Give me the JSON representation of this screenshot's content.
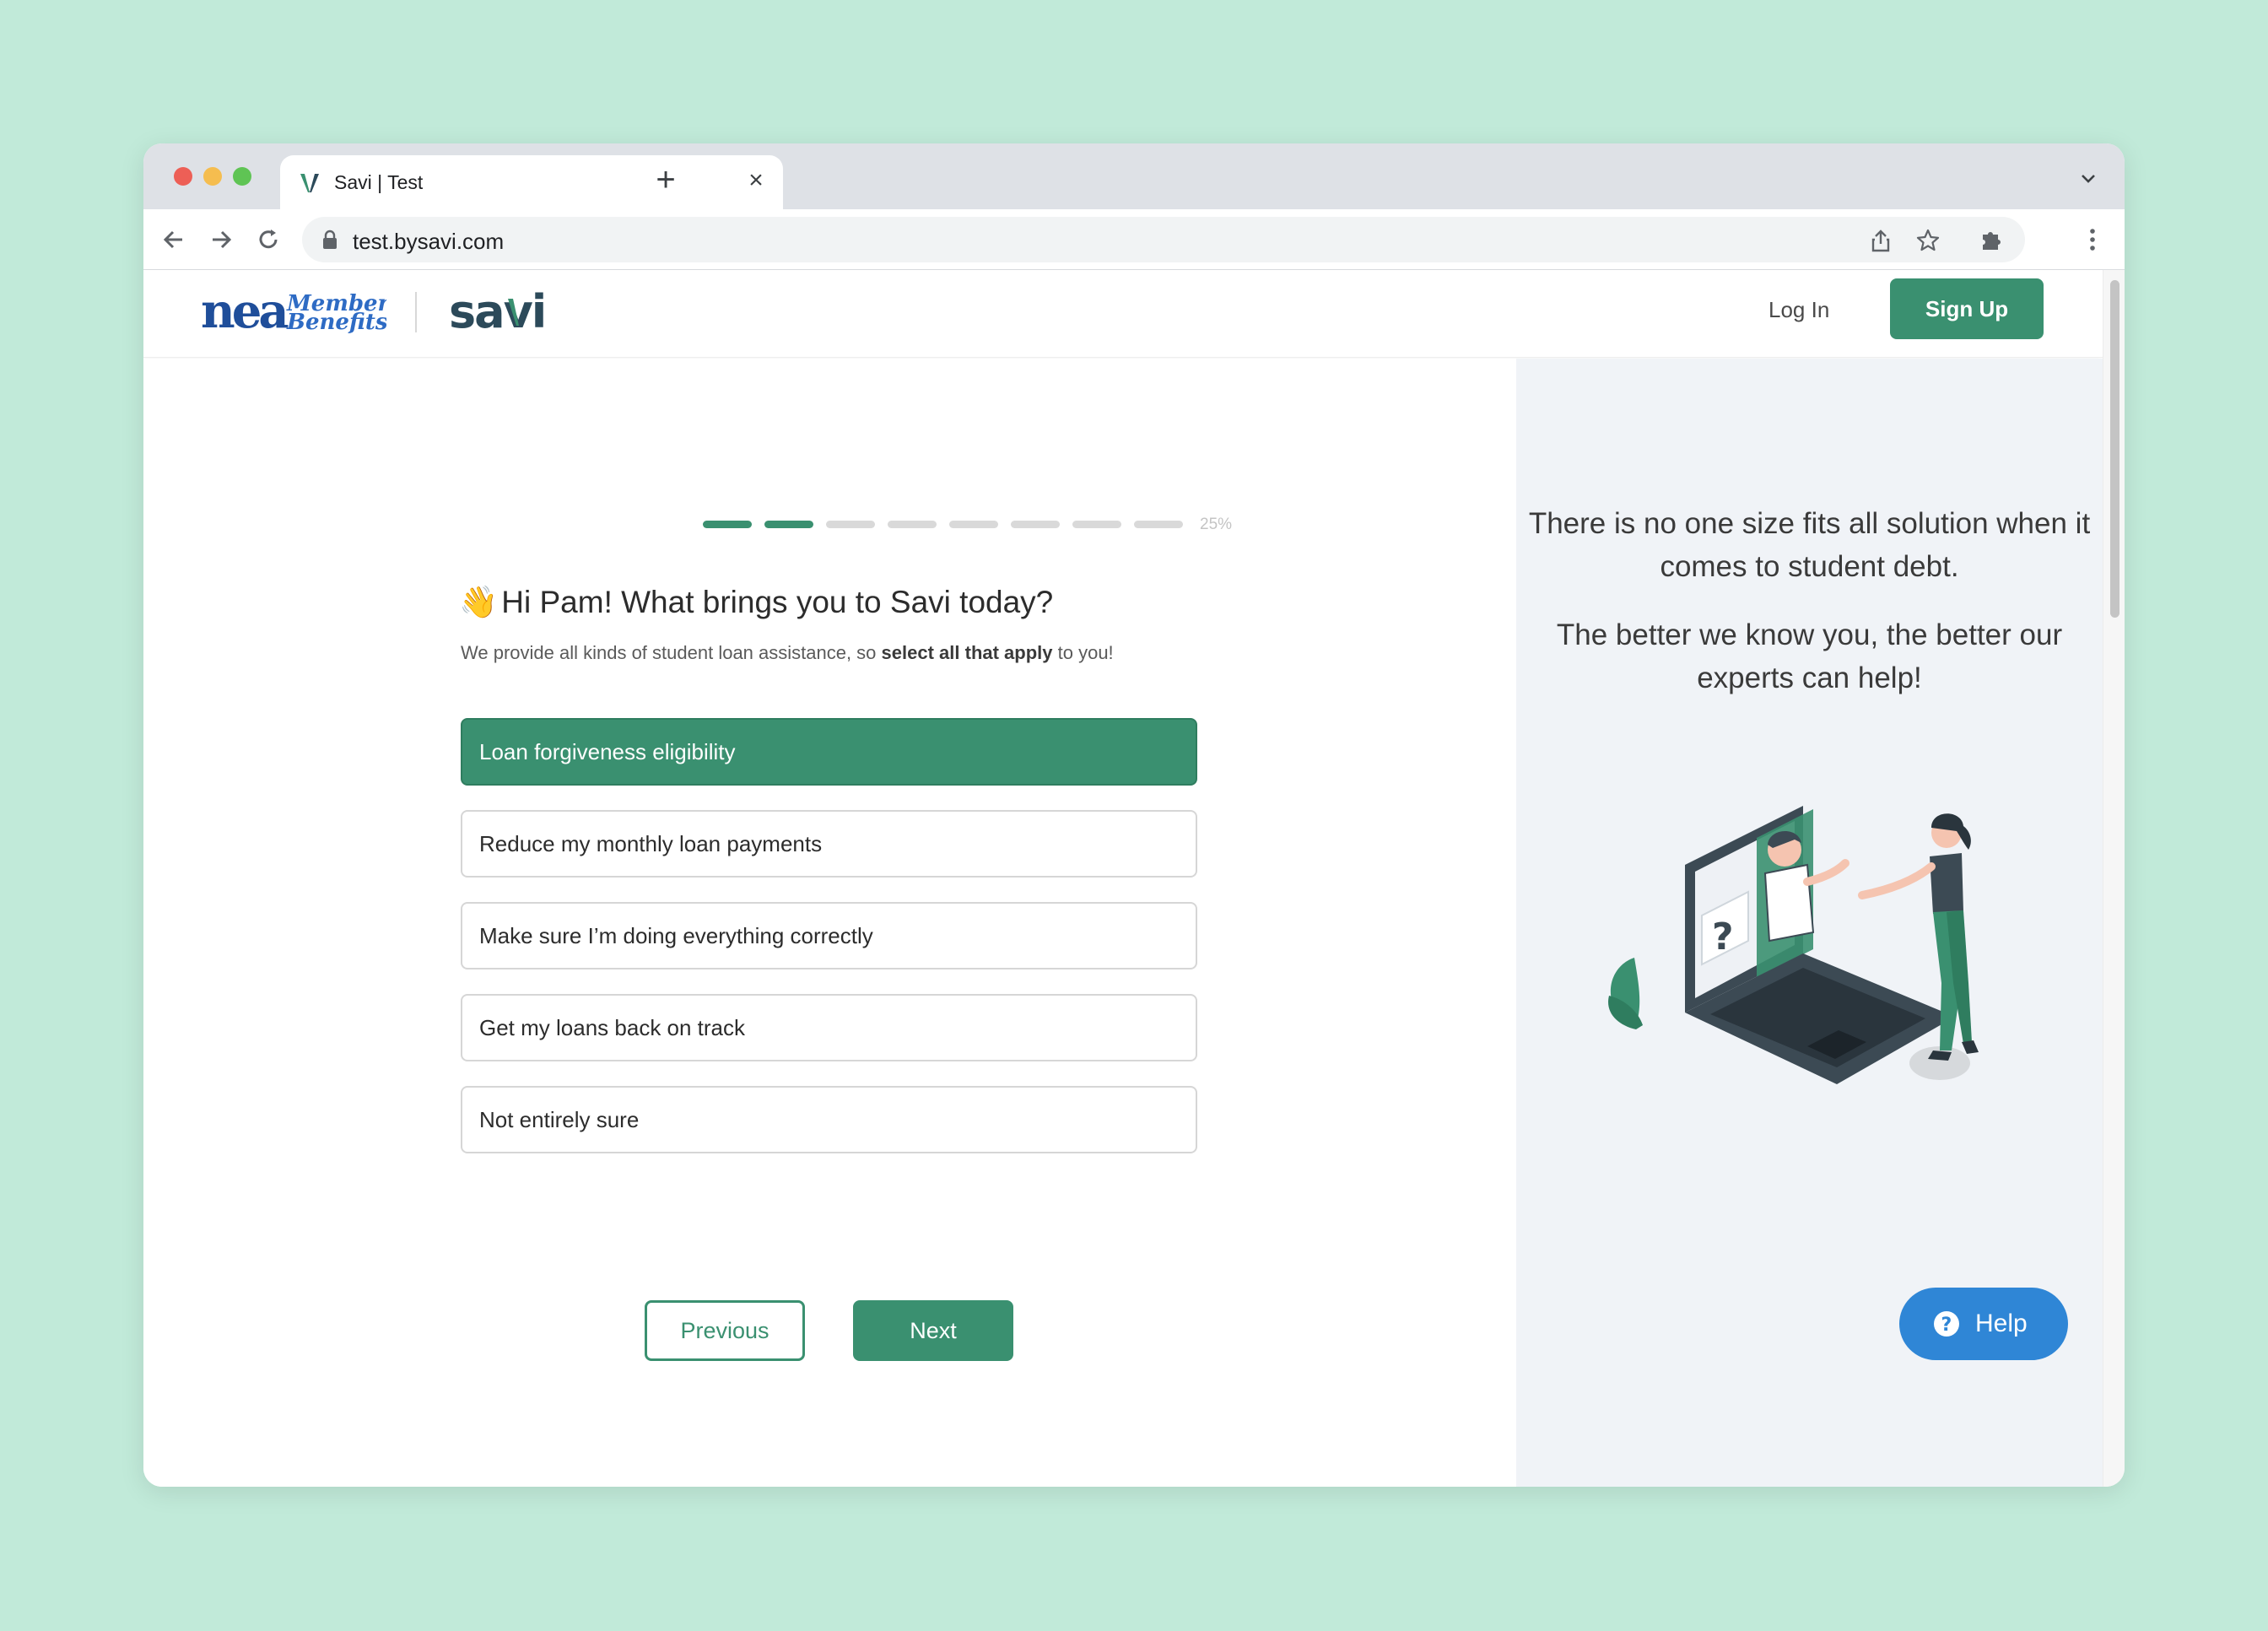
{
  "browser": {
    "tab_title": "Savi | Test",
    "url": "test.bysavi.com"
  },
  "header": {
    "nea_logo_text_1": "nea",
    "nea_logo_text_2": "Member",
    "nea_logo_text_3": "Benefits",
    "savi_logo_text": "savi",
    "login_label": "Log In",
    "signup_label": "Sign Up"
  },
  "progress": {
    "segments_total": 8,
    "segments_done": 2,
    "percent_label": "25%"
  },
  "question": {
    "emoji": "👋",
    "title": "Hi Pam! What brings you to Savi today?",
    "subtitle_pre": "We provide all kinds of student loan assistance, so ",
    "subtitle_bold": "select all that apply",
    "subtitle_post": " to you!"
  },
  "options": [
    {
      "label": "Loan forgiveness eligibility",
      "selected": true
    },
    {
      "label": "Reduce my monthly loan payments",
      "selected": false
    },
    {
      "label": "Make sure I’m doing everything correctly",
      "selected": false
    },
    {
      "label": "Get my loans back on track",
      "selected": false
    },
    {
      "label": "Not entirely sure",
      "selected": false
    }
  ],
  "nav": {
    "previous_label": "Previous",
    "next_label": "Next"
  },
  "sidebar": {
    "line1": "There is no one size fits all solution when it comes to student debt.",
    "line2": "The better we know you, the better our experts can help!"
  },
  "help": {
    "label": "Help"
  },
  "colors": {
    "brand_green": "#3a9070",
    "help_blue": "#2f86d6",
    "background": "#c1ead9",
    "sidebar_bg": "#f0f3f7"
  }
}
